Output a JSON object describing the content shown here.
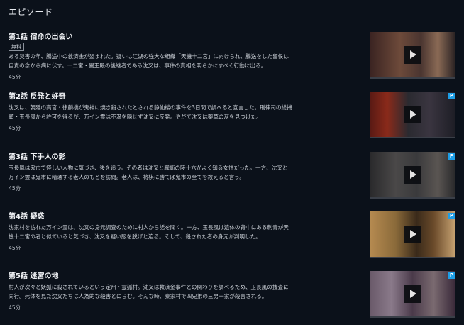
{
  "section_title": "エピソード",
  "episodes": [
    {
      "title": "第1話 宿命の出会い",
      "badge": "無料",
      "desc1": "ある災害の年、騰送中の救済金が盗まれた。疑いは江湖の強大な組織「天機十二宮」に向けられ、騰送をした留侯は",
      "desc2": "自責の念から病に伏す。十二宮・闘王殿の後継者である沈叉は、事件の真相を明らかにすべく行動に出る。",
      "duration": "45分",
      "thumb_icon": "play-icon",
      "premium": false
    },
    {
      "title": "第2話 反発と好奇",
      "badge": "",
      "desc1": "沈叉は、朝廷の高官・徐麟樸が鬼神に焼き殺されたとされる静仙楼の事件を3日間で調べると宣言した。刑律司の総捕",
      "desc2": "頭・玉長風から許可を得るが、万イン霊は不満を隠せず沈叉に反発。やがて沈叉は薬草の灰を見つけた。",
      "duration": "45分",
      "thumb_icon": "play-icon",
      "premium_label": "P",
      "premium": true
    },
    {
      "title": "第3話 下手人の影",
      "badge": "",
      "desc1": "玉長風は鬼市で怪しい人物に気づき、後を追う。その者は沈叉と騰衛の陵十六がよく知る女性だった。一方、沈叉と",
      "desc2": "万イン霊は鬼市に精通する老人のもとを訪問。老人は、将棋に勝てば鬼市の全てを教えると言う。",
      "duration": "45分",
      "thumb_icon": "play-icon",
      "premium_label": "P",
      "premium": true
    },
    {
      "title": "第4話 疑惑",
      "badge": "",
      "desc1": "沈家村を訪れた万イン霊は、沈叉の身元調査のために村人から話を聞く。一方、玉長風は遺体の背中にある刺青が天",
      "desc2": "機十二宮の者と似ていると気づき、沈叉を疑い服を脱げと迫る。そして、殺された者の身元が判明した。",
      "duration": "45分",
      "thumb_icon": "play-icon",
      "premium_label": "P",
      "premium": true
    },
    {
      "title": "第5話 迷宮の地",
      "badge": "",
      "desc1": "村人が次々と妖狐に殺されているという定州・靈狐村。沈叉は救済金事件との関わりを調べるため、玉長風の捜査に",
      "desc2": "同行。死体を見た沈叉たちは人為的な殺害とにらむ。そんな時、秦家村で四兄弟の三男一家が殺害される。",
      "duration": "45分",
      "thumb_icon": "play-icon",
      "premium_label": "P",
      "premium": true
    }
  ]
}
